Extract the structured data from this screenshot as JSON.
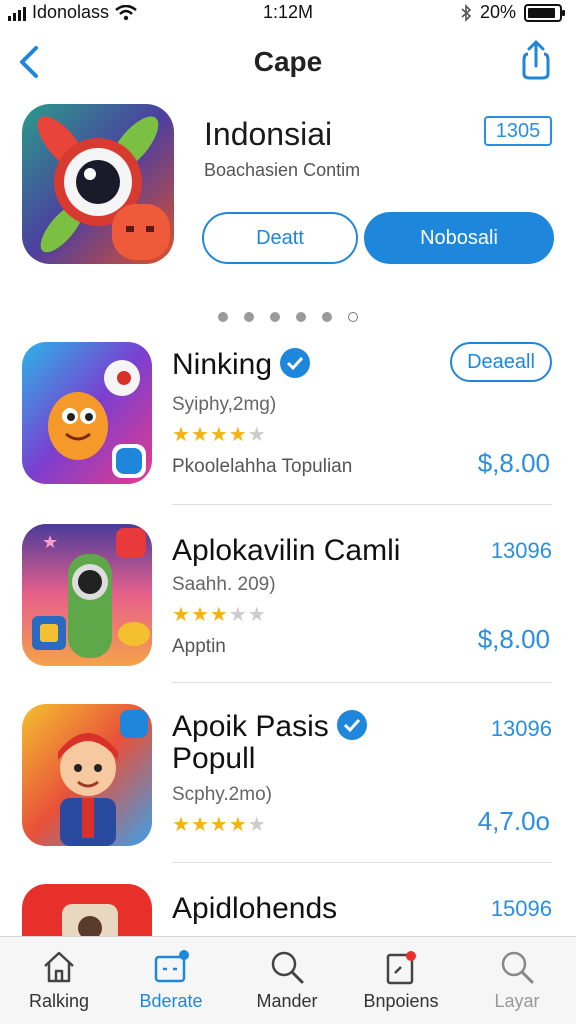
{
  "status_bar": {
    "carrier": "Idonolass",
    "time": "1:12M",
    "battery": "20%",
    "battery_level": 0.9
  },
  "nav": {
    "title": "Cape"
  },
  "featured": {
    "title": "Indonsiai",
    "subtitle": "Boachasien Contim",
    "badge": "1305",
    "button_outline": "Deatt",
    "button_solid": "Nobosali",
    "page_count": 6,
    "active_page": 5
  },
  "apps": [
    {
      "name": "Ninking",
      "verified": true,
      "meta": "Syiphy,2mg)",
      "rating": 4,
      "category": "Pkoolelahha Topulian",
      "action": "Deaeall",
      "price": "$,8.00"
    },
    {
      "name": "Aplokavilin Camli",
      "verified": false,
      "meta": "Saahh. 209)",
      "rating": 3,
      "category": "Apptin",
      "percent": "13096",
      "price": "$,8.00"
    },
    {
      "name": "Apoik Pasis",
      "name2": "Popull",
      "verified": true,
      "meta": "Scphy.2mo)",
      "rating": 4,
      "percent": "13096",
      "price": "4,7.0o"
    },
    {
      "name": "Apidlohends",
      "percent": "15096"
    }
  ],
  "tabs": [
    {
      "label": "Ralking",
      "icon": "home-icon"
    },
    {
      "label": "Bderate",
      "icon": "games-icon",
      "active": true
    },
    {
      "label": "Mander",
      "icon": "search-icon"
    },
    {
      "label": "Bnpoiens",
      "icon": "updates-icon"
    },
    {
      "label": "Layar",
      "icon": "search-icon"
    }
  ],
  "colors": {
    "accent": "#1e86db",
    "star": "#f3b410"
  }
}
